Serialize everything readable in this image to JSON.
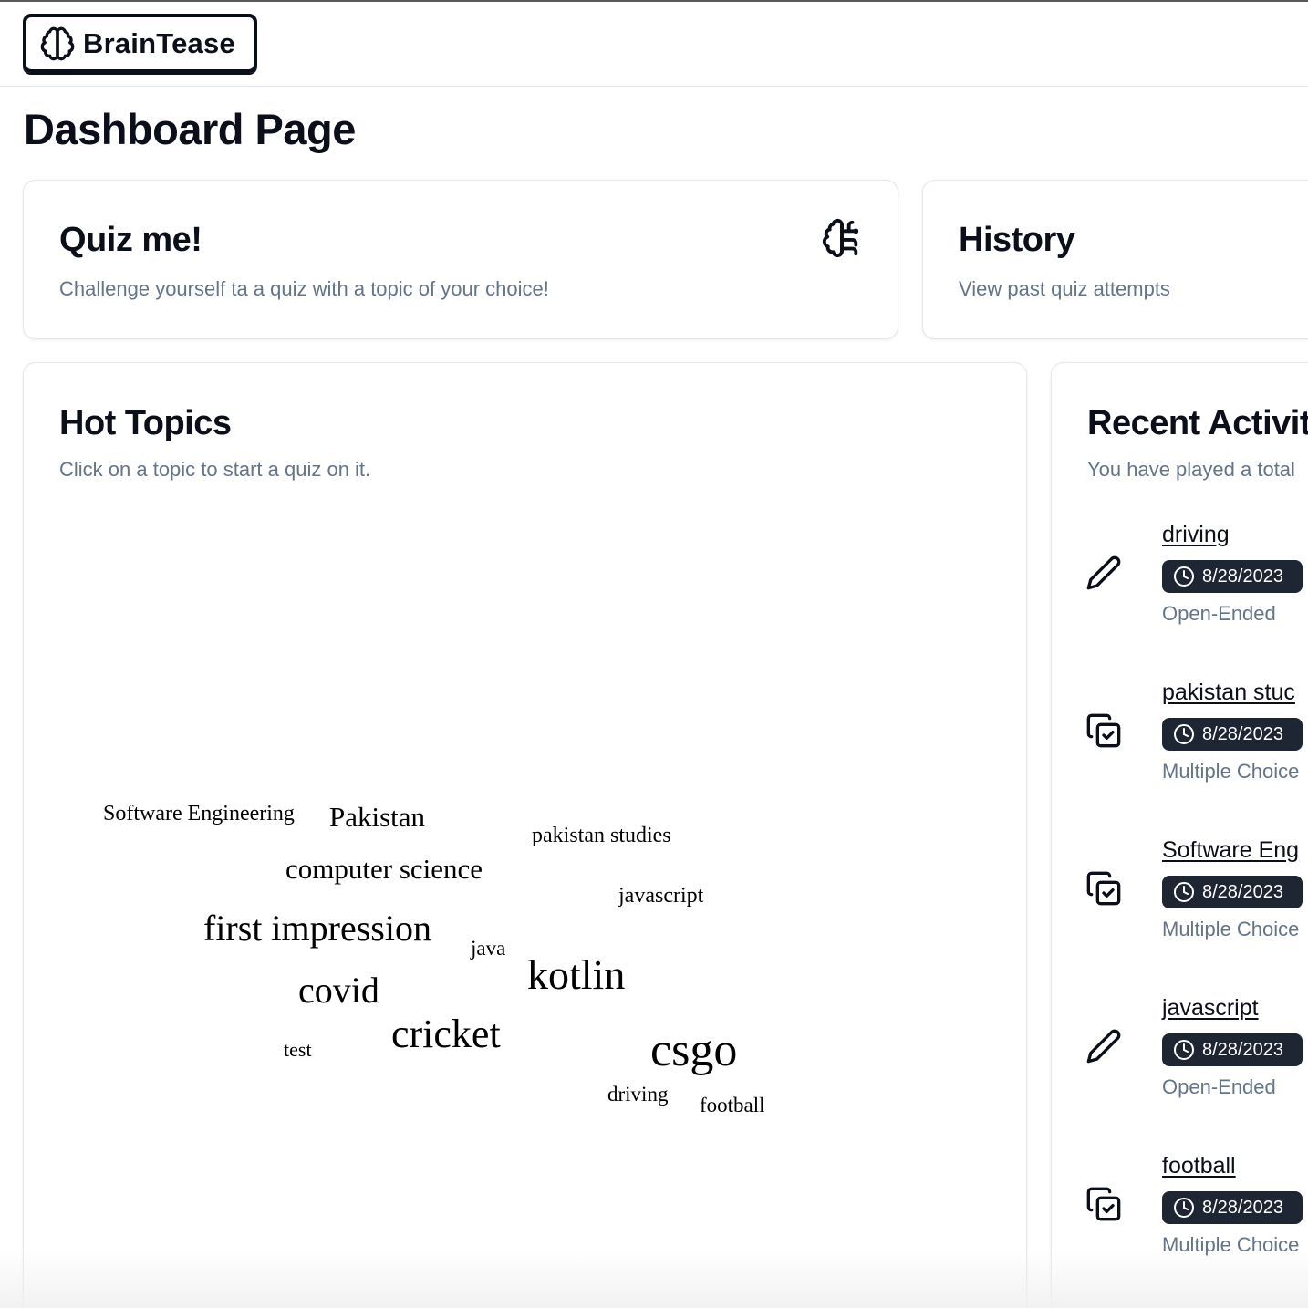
{
  "brand": {
    "name": "BrainTease"
  },
  "page": {
    "title": "Dashboard Page"
  },
  "quiz_card": {
    "title": "Quiz me!",
    "description": "Challenge yourself ta a quiz with a topic of your choice!",
    "icon": "brain-circuit-icon"
  },
  "history_card": {
    "title": "History",
    "description": "View past quiz attempts"
  },
  "hot_topics": {
    "title": "Hot Topics",
    "description": "Click on a topic to start a quiz on it.",
    "words": [
      "Software Engineering",
      "Pakistan",
      "pakistan studies",
      "computer science",
      "javascript",
      "first impression",
      "java",
      "kotlin",
      "covid",
      "cricket",
      "test",
      "csgo",
      "driving",
      "football"
    ]
  },
  "recent_activity": {
    "title": "Recent Activit",
    "description": "You have played a total",
    "items": [
      {
        "topic": "driving",
        "date": "8/28/2023",
        "type": "Open-Ended",
        "icon": "pencil-icon"
      },
      {
        "topic": "pakistan stuc",
        "date": "8/28/2023",
        "type": "Multiple Choice",
        "icon": "copy-check-icon"
      },
      {
        "topic": "Software Eng",
        "date": "8/28/2023",
        "type": "Multiple Choice",
        "icon": "copy-check-icon"
      },
      {
        "topic": "javascript",
        "date": "8/28/2023",
        "type": "Open-Ended",
        "icon": "pencil-icon"
      },
      {
        "topic": "football",
        "date": "8/28/2023",
        "type": "Multiple Choice",
        "icon": "copy-check-icon"
      }
    ]
  }
}
